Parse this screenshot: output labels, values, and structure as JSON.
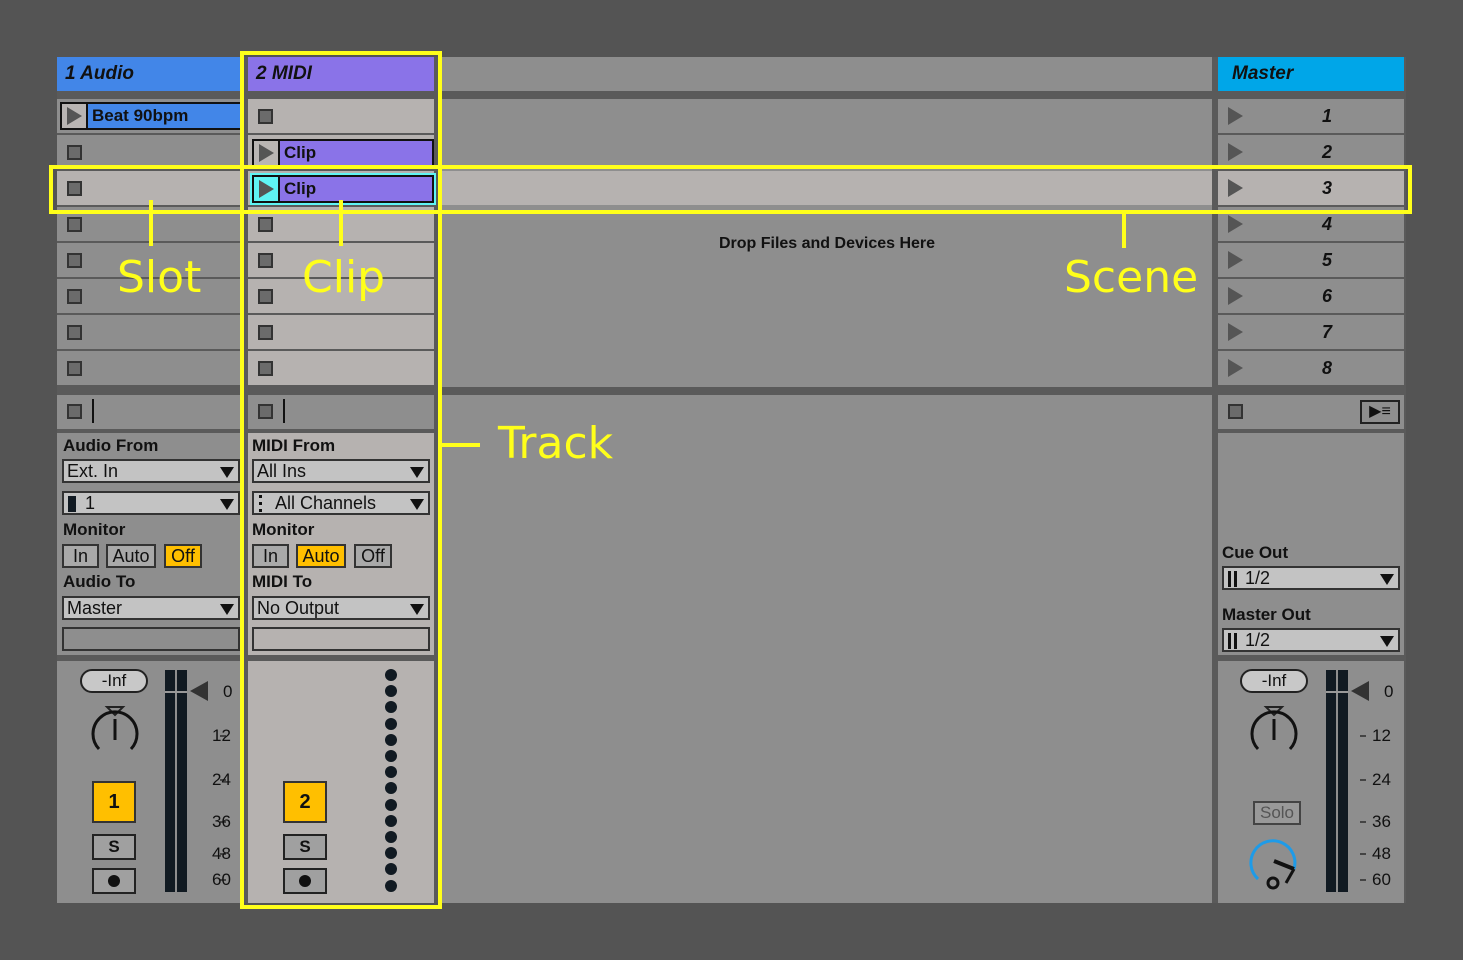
{
  "tracks": [
    {
      "title": "1 Audio",
      "color": "#4286e8",
      "clips": [
        {
          "slot": 1,
          "name": "Beat 90bpm"
        }
      ],
      "io": {
        "from_label": "Audio From",
        "from_value": "Ext. In",
        "channel_value": "1",
        "monitor_label": "Monitor",
        "monitor_options": [
          "In",
          "Auto",
          "Off"
        ],
        "monitor_selected": "Off",
        "to_label": "Audio To",
        "to_value": "Master"
      },
      "mixer": {
        "volume": "-Inf",
        "number": "1",
        "solo": "S",
        "arm_icon": "record-icon"
      }
    },
    {
      "title": "2 MIDI",
      "color": "#8a73e8",
      "clips": [
        {
          "slot": 2,
          "name": "Clip"
        },
        {
          "slot": 3,
          "name": "Clip"
        }
      ],
      "io": {
        "from_label": "MIDI From",
        "from_value": "All Ins",
        "channel_value": "All Channels",
        "monitor_label": "Monitor",
        "monitor_options": [
          "In",
          "Auto",
          "Off"
        ],
        "monitor_selected": "Auto",
        "to_label": "MIDI To",
        "to_value": "No Output"
      },
      "mixer": {
        "number": "2",
        "solo": "S",
        "arm_icon": "midi-record-icon"
      }
    }
  ],
  "drop_hint": "Drop Files and Devices Here",
  "master": {
    "title": "Master",
    "color": "#00a6e8",
    "scenes": [
      "1",
      "2",
      "3",
      "4",
      "5",
      "6",
      "7",
      "8"
    ],
    "selected_scene": "3",
    "cue_out_label": "Cue Out",
    "cue_out_value": "1/2",
    "master_out_label": "Master Out",
    "master_out_value": "1/2",
    "volume": "-Inf",
    "solo_label": "Solo"
  },
  "meter_scale": [
    "0",
    "12",
    "24",
    "36",
    "48",
    "60"
  ],
  "annotations": {
    "slot": "Slot",
    "clip": "Clip",
    "scene": "Scene",
    "track": "Track"
  }
}
